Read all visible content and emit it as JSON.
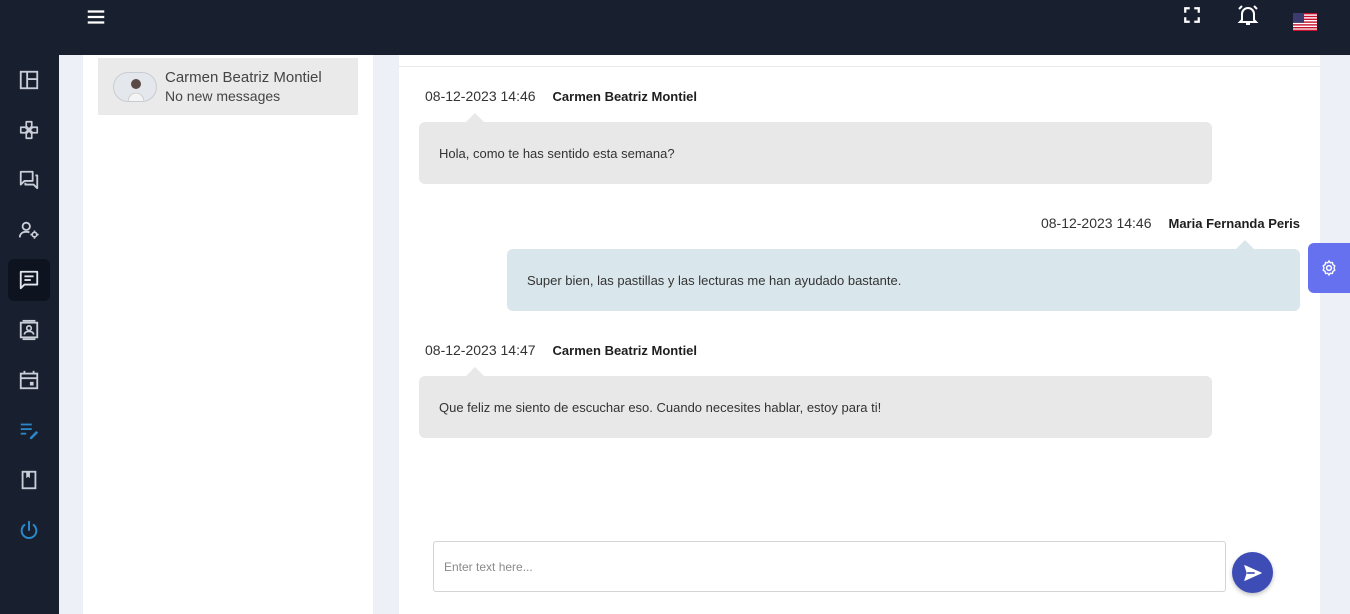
{
  "colors": {
    "sidebar_bg": "#181f2e",
    "accent": "#3d4db5",
    "settings_tab": "#6571ef",
    "incoming_bubble": "#e8e8e8",
    "outgoing_bubble": "#d9e6ec"
  },
  "topbar": {
    "icons": [
      "menu-icon",
      "fullscreen-icon",
      "alarm-bell-icon",
      "us-flag-icon"
    ]
  },
  "sidebar": {
    "items": [
      {
        "icon": "dashboard-icon"
      },
      {
        "icon": "gamepad-icon"
      },
      {
        "icon": "forum-icon"
      },
      {
        "icon": "user-settings-icon"
      },
      {
        "icon": "chat-icon",
        "active": true
      },
      {
        "icon": "contact-card-icon"
      },
      {
        "icon": "calendar-icon"
      },
      {
        "icon": "edit-notes-icon"
      },
      {
        "icon": "book-icon"
      },
      {
        "icon": "power-icon"
      }
    ]
  },
  "contacts": [
    {
      "name": "Carmen Beatriz Montiel",
      "status": "No new messages"
    }
  ],
  "messages": [
    {
      "timestamp": "08-12-2023 14:46",
      "sender": "Carmen Beatriz Montiel",
      "text": "Hola, como te has sentido esta semana?",
      "side": "left"
    },
    {
      "timestamp": "08-12-2023 14:46",
      "sender": "Maria Fernanda Peris",
      "text": "Super bien, las pastillas y las lecturas me han ayudado bastante.",
      "side": "right"
    },
    {
      "timestamp": "08-12-2023 14:47",
      "sender": "Carmen Beatriz Montiel",
      "text": "Que feliz me siento de escuchar eso. Cuando necesites hablar, estoy para ti!",
      "side": "left"
    }
  ],
  "composer": {
    "placeholder": "Enter text here...",
    "value": ""
  }
}
